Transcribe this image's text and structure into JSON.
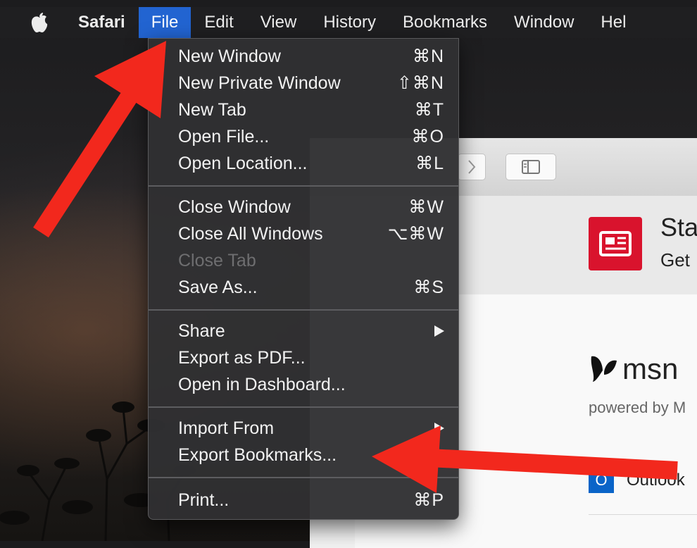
{
  "menubar": {
    "app": "Safari",
    "items": [
      "File",
      "Edit",
      "View",
      "History",
      "Bookmarks",
      "Window",
      "Hel"
    ]
  },
  "file_menu": {
    "items": [
      {
        "label": "New Window",
        "shortcut": "⌘N"
      },
      {
        "label": "New Private Window",
        "shortcut": "⇧⌘N"
      },
      {
        "label": "New Tab",
        "shortcut": "⌘T"
      },
      {
        "label": "Open File...",
        "shortcut": "⌘O"
      },
      {
        "label": "Open Location...",
        "shortcut": "⌘L"
      },
      {
        "label": "Close Window",
        "shortcut": "⌘W"
      },
      {
        "label": "Close All Windows",
        "shortcut": "⌥⌘W"
      },
      {
        "label": "Close Tab",
        "shortcut": ""
      },
      {
        "label": "Save As...",
        "shortcut": "⌘S"
      },
      {
        "label": "Share",
        "shortcut": ""
      },
      {
        "label": "Export as PDF...",
        "shortcut": ""
      },
      {
        "label": "Open in Dashboard...",
        "shortcut": ""
      },
      {
        "label": "Import From",
        "shortcut": ""
      },
      {
        "label": "Export Bookmarks...",
        "shortcut": ""
      },
      {
        "label": "Print...",
        "shortcut": "⌘P"
      }
    ]
  },
  "safari_page": {
    "banner_title": "Sta",
    "banner_sub": "Get",
    "msn_brand": "msn",
    "msn_powered": "powered by M",
    "outlook_label": "Outlook",
    "outlook_letter": "O"
  },
  "colors": {
    "menu_highlight": "#2264d1",
    "annotation_arrow": "#f2281d",
    "news_tile": "#d9132d"
  }
}
